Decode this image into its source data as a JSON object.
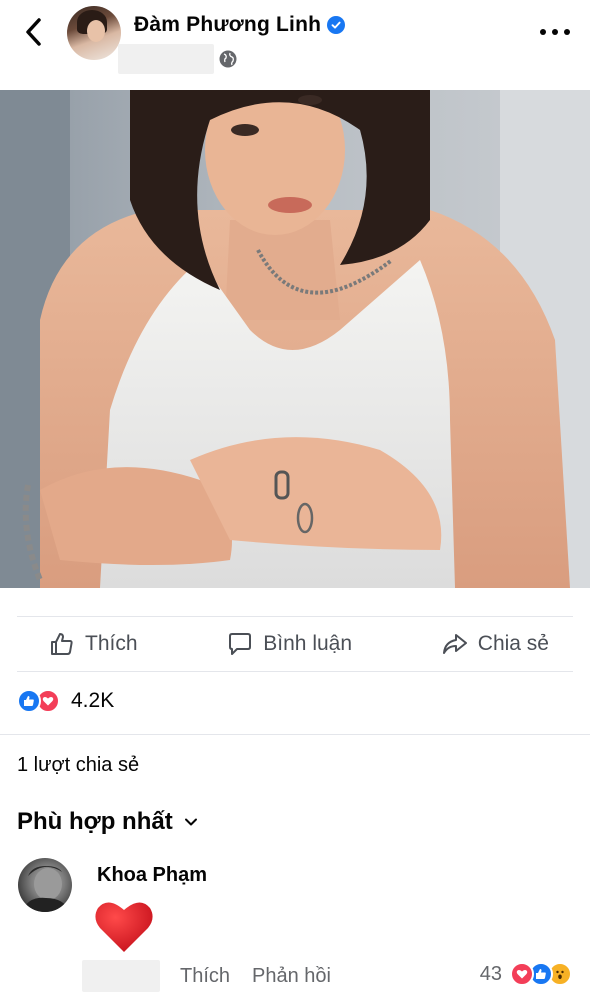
{
  "post": {
    "author": "Đàm Phương Linh",
    "verified": true,
    "privacy_icon": "globe-icon"
  },
  "actions": {
    "like_label": "Thích",
    "comment_label": "Bình luận",
    "share_label": "Chia sẻ"
  },
  "reactions": {
    "types": [
      "like",
      "love"
    ],
    "count": "4.2K"
  },
  "shares_text": "1 lượt chia sẻ",
  "comments": {
    "sort_label": "Phù hợp nhất",
    "items": [
      {
        "author": "Khoa Phạm",
        "content_icon": "red-heart",
        "like_label": "Thích",
        "reply_label": "Phản hồi",
        "reaction_count": "43",
        "reaction_types": [
          "love",
          "like",
          "wow"
        ]
      }
    ]
  },
  "colors": {
    "brand_blue": "#1877f2",
    "love_red": "#f33e58",
    "wow_yellow": "#f7b125",
    "secondary_text": "#65676b"
  }
}
